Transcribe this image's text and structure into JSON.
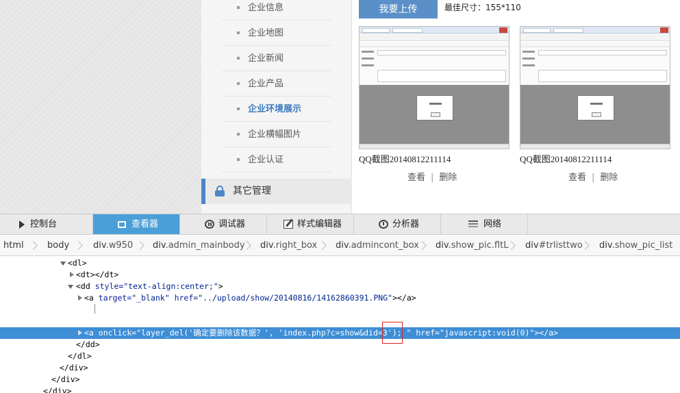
{
  "sidebar": {
    "items": [
      {
        "label": "企业信息",
        "active": false
      },
      {
        "label": "企业地图",
        "active": false
      },
      {
        "label": "企业新闻",
        "active": false
      },
      {
        "label": "企业产品",
        "active": false
      },
      {
        "label": "企业环境展示",
        "active": true
      },
      {
        "label": "企业横幅图片",
        "active": false
      },
      {
        "label": "企业认证",
        "active": false
      }
    ],
    "section_label": "其它管理",
    "accent_color": "#4b86c6"
  },
  "main": {
    "upload_label": "我要上传",
    "size_hint": "最佳尺寸：155*110",
    "thumbnails": [
      {
        "name": "QQ截图20140812211114",
        "view_label": "查看",
        "delete_label": "删除"
      },
      {
        "name": "QQ截图20140812211114",
        "view_label": "查看",
        "delete_label": "删除"
      }
    ]
  },
  "devtools": {
    "tabs": [
      {
        "label": "控制台",
        "icon": "console-icon",
        "active": false
      },
      {
        "label": "查看器",
        "icon": "inspector-icon",
        "active": true
      },
      {
        "label": "调试器",
        "icon": "debugger-icon",
        "active": false
      },
      {
        "label": "样式编辑器",
        "icon": "style-editor-icon",
        "active": false
      },
      {
        "label": "分析器",
        "icon": "profiler-icon",
        "active": false
      },
      {
        "label": "网络",
        "icon": "network-icon",
        "active": false
      }
    ],
    "breadcrumbs": [
      {
        "tag": "html",
        "cls": ""
      },
      {
        "tag": "body",
        "cls": ""
      },
      {
        "tag": "div",
        "cls": ".w950"
      },
      {
        "tag": "div",
        "cls": ".admin_mainbody"
      },
      {
        "tag": "div",
        "cls": ".right_box"
      },
      {
        "tag": "div",
        "cls": ".admincont_box"
      },
      {
        "tag": "div",
        "cls": ".show_pic.fltL"
      },
      {
        "tag": "div",
        "cls": "#trlisttwo"
      },
      {
        "tag": "div",
        "cls": ".show_pic_list"
      }
    ],
    "tree": {
      "dl_open": "<dl>",
      "dt": "<dt></dt>",
      "dd_open_tag": "<dd ",
      "dd_attr": "style=",
      "dd_val": "\"text-align:center;\"",
      "dd_close": ">",
      "a1_open": "<a ",
      "a1_attr1": "target=",
      "a1_val1": "\"_blank\"",
      "a1_attr2": " href=",
      "a1_val2": "\"../upload/show/20140816/14162860391.PNG\"",
      "a1_close": "></a>",
      "a2_open": "<a ",
      "a2_attr1": "onclick=",
      "a2_val1": "\"layer_del('确定要删除该数据？', 'index.php?c=show&did=3'); \"",
      "a2_attr2": " href=",
      "a2_val2": "\"javascript:void(0)\"",
      "a2_close": "></a>",
      "dd_end": "</dd>",
      "dl_end": "</dl>",
      "div_end": "</div>"
    },
    "selected_color": "#3e8ed6"
  }
}
